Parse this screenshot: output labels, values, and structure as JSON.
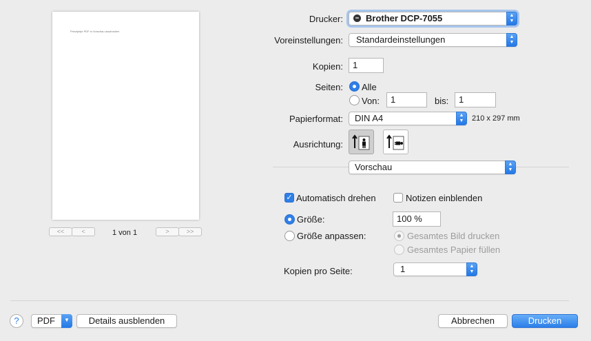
{
  "preview": {
    "page_text": "Prinzipleje PDF in Vorschau ausdrucken",
    "page_counter": "1 von 1",
    "nav_first": "<<",
    "nav_prev": "<",
    "nav_next": ">",
    "nav_last": ">>"
  },
  "printer": {
    "label": "Drucker:",
    "value": "Brother DCP-7055"
  },
  "presets": {
    "label": "Voreinstellungen:",
    "value": "Standardeinstellungen"
  },
  "copies": {
    "label": "Kopien:",
    "value": "1"
  },
  "pages": {
    "label": "Seiten:",
    "all_label": "Alle",
    "from_label": "Von:",
    "from_value": "1",
    "to_label": "bis:",
    "to_value": "1"
  },
  "paper": {
    "label": "Papierformat:",
    "value": "DIN A4",
    "size_text": "210 x 297 mm"
  },
  "orientation": {
    "label": "Ausrichtung:"
  },
  "app_section": {
    "value": "Vorschau"
  },
  "options": {
    "auto_rotate": "Automatisch drehen",
    "show_notes": "Notizen einblenden",
    "size_label": "Größe:",
    "size_value": "100 %",
    "fit_label": "Größe anpassen:",
    "print_whole_image": "Gesamtes Bild drucken",
    "fill_whole_paper": "Gesamtes Papier füllen",
    "pages_per_sheet_label": "Kopien pro Seite:",
    "pages_per_sheet_value": "1"
  },
  "footer": {
    "help": "?",
    "pdf": "PDF",
    "hide_details": "Details ausblenden",
    "cancel": "Abbrechen",
    "print": "Drucken"
  },
  "colors": {
    "accent": "#2f7fe8",
    "background": "#ececec"
  }
}
